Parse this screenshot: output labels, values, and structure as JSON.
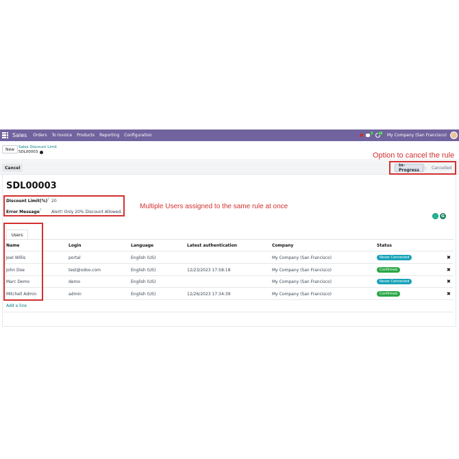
{
  "navbar": {
    "app_name": "Sales",
    "menus": [
      "Orders",
      "To Invoice",
      "Products",
      "Reporting",
      "Configuration"
    ],
    "activity_badge": "5",
    "timer_badge": "39",
    "company": "My Company (San Francisco)"
  },
  "control": {
    "new_label": "New",
    "breadcrumb_parent": "Sales Discount Limit",
    "breadcrumb_current": "SDL00003"
  },
  "annotations": {
    "cancel_rule": "Option to cancel the rule",
    "multi_users": "Multiple Users assigned to the same rule at once"
  },
  "statusbar": {
    "cancel_label": "Cancel",
    "stages": [
      "In-Progress",
      "Cancelled"
    ],
    "active_stage": "In-Progress"
  },
  "record": {
    "title": "SDL00003",
    "fields": [
      {
        "label": "Discount Limit(%)",
        "help": "?",
        "value": "20"
      },
      {
        "label": "Error Message",
        "help": "?",
        "value": "Alert! Only 20% Discount Allowed."
      }
    ]
  },
  "notebook": {
    "tab_label": "Users",
    "columns": [
      "Name",
      "Login",
      "Language",
      "Latest authentication",
      "Company",
      "Status"
    ],
    "rows": [
      {
        "name": "Joel Willis",
        "login": "portal",
        "language": "English (US)",
        "auth": "",
        "company": "My Company (San Francisco)",
        "status": "Never Connected",
        "status_color": "#17a2b8"
      },
      {
        "name": "John Doe",
        "login": "test@odoo.com",
        "language": "English (US)",
        "auth": "12/23/2023 17:58:18",
        "company": "My Company (San Francisco)",
        "status": "Confirmed",
        "status_color": "#28a745"
      },
      {
        "name": "Marc Demo",
        "login": "demo",
        "language": "English (US)",
        "auth": "",
        "company": "My Company (San Francisco)",
        "status": "Never Connected",
        "status_color": "#17a2b8"
      },
      {
        "name": "Mitchell Admin",
        "login": "admin",
        "language": "English (US)",
        "auth": "12/26/2023 17:34:39",
        "company": "My Company (San Francisco)",
        "status": "Confirmed",
        "status_color": "#28a745"
      }
    ],
    "add_line_label": "Add a line"
  }
}
